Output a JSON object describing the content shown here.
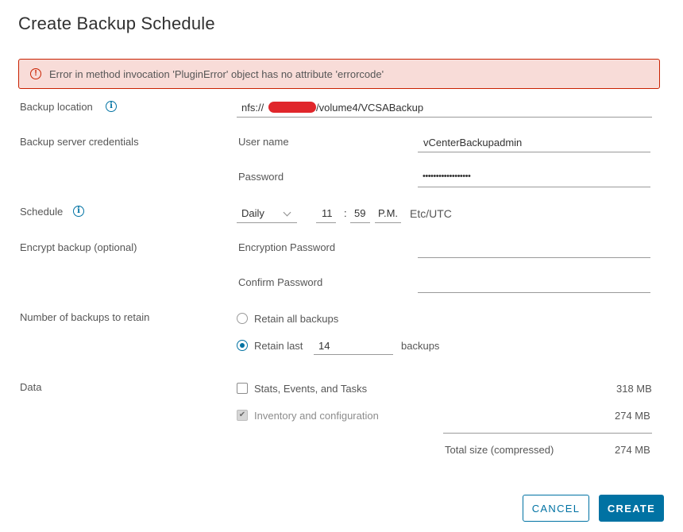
{
  "dialog": {
    "title": "Create Backup Schedule"
  },
  "alert": {
    "icon": "error-circle-icon",
    "message": "Error in method invocation 'PluginError' object has no attribute 'errorcode'"
  },
  "backup_location": {
    "label": "Backup location",
    "value_prefix": "nfs://",
    "value_suffix": "/volume4/VCSABackup"
  },
  "credentials": {
    "label": "Backup server credentials",
    "username_label": "User name",
    "username_value": "vCenterBackupadmin",
    "password_label": "Password",
    "password_value": "••••••••••••••••••"
  },
  "schedule": {
    "label": "Schedule",
    "frequency": "Daily",
    "hour": "11",
    "separator": ":",
    "minute": "59",
    "meridiem": "P.M.",
    "timezone": "Etc/UTC"
  },
  "encrypt": {
    "label": "Encrypt backup (optional)",
    "encryption_password_label": "Encryption Password",
    "encryption_password_value": "",
    "confirm_password_label": "Confirm Password",
    "confirm_password_value": ""
  },
  "retain": {
    "label": "Number of backups to retain",
    "option_all": "Retain all backups",
    "option_last": "Retain last",
    "last_value": "14",
    "suffix": "backups",
    "selected": "last"
  },
  "data": {
    "label": "Data",
    "items": [
      {
        "label": "Stats, Events, and Tasks",
        "size": "318 MB",
        "checked": false,
        "disabled": false
      },
      {
        "label": "Inventory and configuration",
        "size": "274 MB",
        "checked": true,
        "disabled": true
      }
    ],
    "total_label": "Total size (compressed)",
    "total_size": "274 MB"
  },
  "footer": {
    "cancel_label": "CANCEL",
    "create_label": "CREATE"
  },
  "colors": {
    "accent": "#0072a3",
    "error_border": "#c92100",
    "error_bg": "#f8dcd8",
    "redaction": "#e0262b"
  }
}
